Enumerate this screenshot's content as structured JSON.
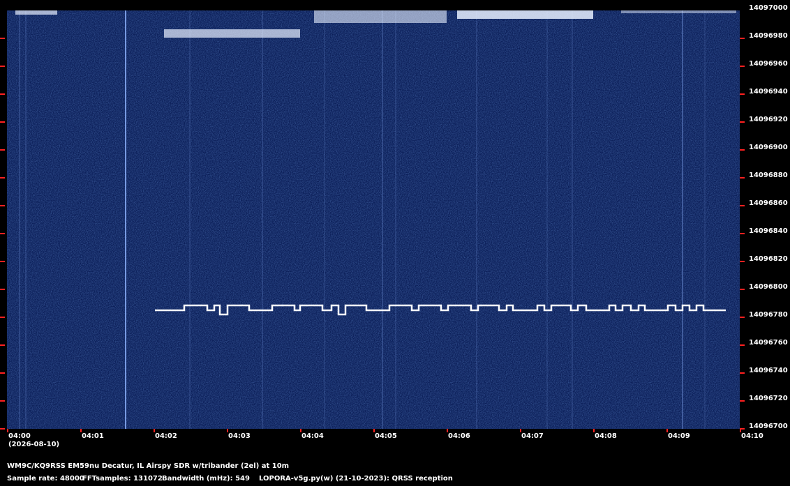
{
  "y_axis": {
    "labels": [
      "14097000",
      "14096980",
      "14096960",
      "14096940",
      "14096920",
      "14096900",
      "14096880",
      "14096860",
      "14096840",
      "14096820",
      "14096800",
      "14096780",
      "14096760",
      "14096740",
      "14096720",
      "14096700"
    ]
  },
  "x_axis": {
    "labels": [
      "04:00",
      "04:01",
      "04:02",
      "04:03",
      "04:04",
      "04:05",
      "04:06",
      "04:07",
      "04:08",
      "04:09",
      "04:10"
    ],
    "date": "(2026-08-10)"
  },
  "footer": {
    "station": "WM9C/KQ9RSS EM59nu Decatur, IL  Airspy SDR w/tribander (2el) at 10m",
    "sample_rate": "Sample rate: 48000",
    "fft_samples": "FFTsamples: 131072",
    "bandwidth": "Bandwidth (mHz): 549",
    "software": "LOPORA-v5g.py(w) (21-10-2023): QRSS reception"
  },
  "colors": {
    "background": "#000000",
    "waterfall": "#0a1f5a",
    "signal": "#ffffff",
    "tick": "#ff2020"
  }
}
